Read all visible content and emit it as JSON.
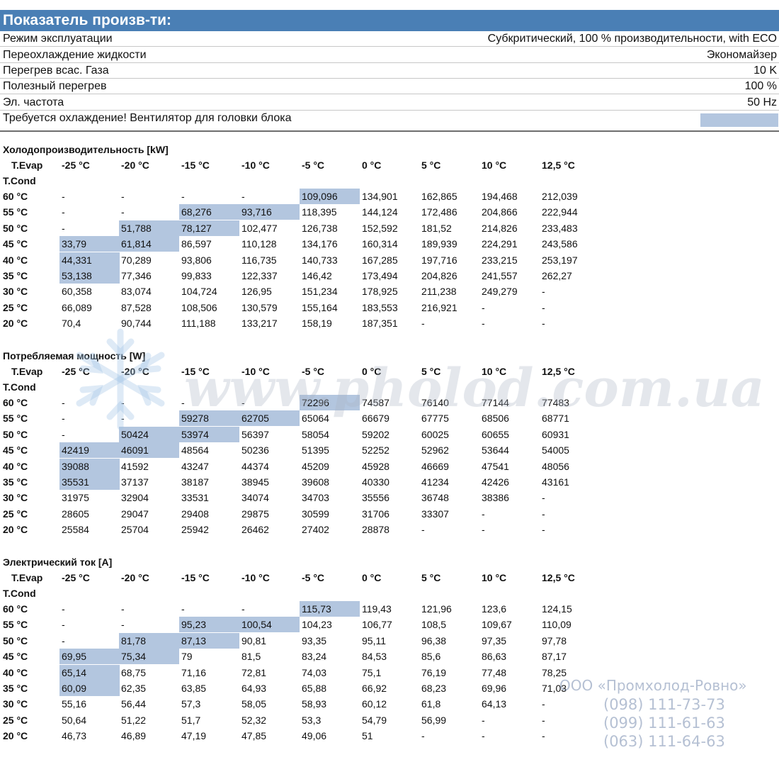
{
  "header": {
    "title": "Показатель произв-ти:"
  },
  "properties": [
    {
      "label": "Режим эксплуатации",
      "value": "Субкритический, 100 % производительности, with ECO"
    },
    {
      "label": "Переохлаждение жидкости",
      "value": "Экономайзер"
    },
    {
      "label": "Перегрев всас. Газа",
      "value": "10 K"
    },
    {
      "label": "Полезный перегрев",
      "value": "100 %"
    },
    {
      "label": "Эл. частота",
      "value": "50 Hz"
    },
    {
      "label": "Требуется охлаждение! Вентилятор для головки блока",
      "value": ""
    }
  ],
  "table_header": {
    "evap_label": "T.Evap",
    "cond_label": "T.Cond",
    "columns": [
      "-25 °C",
      "-20 °C",
      "-15 °C",
      "-10 °C",
      "-5 °C",
      "0 °C",
      "5 °C",
      "10 °C",
      "12,5 °C"
    ],
    "rows": [
      "60 °C",
      "55 °C",
      "50 °C",
      "45 °C",
      "40 °C",
      "35 °C",
      "30 °C",
      "25 °C",
      "20 °C"
    ]
  },
  "sections": [
    {
      "title": "Холодопроизводительность [kW]",
      "values": [
        [
          "-",
          "-",
          "-",
          "-",
          "109,096",
          "134,901",
          "162,865",
          "194,468",
          "212,039"
        ],
        [
          "-",
          "-",
          "68,276",
          "93,716",
          "118,395",
          "144,124",
          "172,486",
          "204,866",
          "222,944"
        ],
        [
          "-",
          "51,788",
          "78,127",
          "102,477",
          "126,738",
          "152,592",
          "181,52",
          "214,826",
          "233,483"
        ],
        [
          "33,79",
          "61,814",
          "86,597",
          "110,128",
          "134,176",
          "160,314",
          "189,939",
          "224,291",
          "243,586"
        ],
        [
          "44,331",
          "70,289",
          "93,806",
          "116,735",
          "140,733",
          "167,285",
          "197,716",
          "233,215",
          "253,197"
        ],
        [
          "53,138",
          "77,346",
          "99,833",
          "122,337",
          "146,42",
          "173,494",
          "204,826",
          "241,557",
          "262,27"
        ],
        [
          "60,358",
          "83,074",
          "104,724",
          "126,95",
          "151,234",
          "178,925",
          "211,238",
          "249,279",
          "-"
        ],
        [
          "66,089",
          "87,528",
          "108,506",
          "130,579",
          "155,164",
          "183,553",
          "216,921",
          "-",
          "-"
        ],
        [
          "70,4",
          "90,744",
          "111,188",
          "133,217",
          "158,19",
          "187,351",
          "-",
          "-",
          "-"
        ]
      ]
    },
    {
      "title": "Потребляемая мощность [W]",
      "values": [
        [
          "-",
          "-",
          "-",
          "-",
          "72296",
          "74587",
          "76140",
          "77144",
          "77483"
        ],
        [
          "-",
          "-",
          "59278",
          "62705",
          "65064",
          "66679",
          "67775",
          "68506",
          "68771"
        ],
        [
          "-",
          "50424",
          "53974",
          "56397",
          "58054",
          "59202",
          "60025",
          "60655",
          "60931"
        ],
        [
          "42419",
          "46091",
          "48564",
          "50236",
          "51395",
          "52252",
          "52962",
          "53644",
          "54005"
        ],
        [
          "39088",
          "41592",
          "43247",
          "44374",
          "45209",
          "45928",
          "46669",
          "47541",
          "48056"
        ],
        [
          "35531",
          "37137",
          "38187",
          "38945",
          "39608",
          "40330",
          "41234",
          "42426",
          "43161"
        ],
        [
          "31975",
          "32904",
          "33531",
          "34074",
          "34703",
          "35556",
          "36748",
          "38386",
          "-"
        ],
        [
          "28605",
          "29047",
          "29408",
          "29875",
          "30599",
          "31706",
          "33307",
          "-",
          "-"
        ],
        [
          "25584",
          "25704",
          "25942",
          "26462",
          "27402",
          "28878",
          "-",
          "-",
          "-"
        ]
      ]
    },
    {
      "title": "Электрический ток [A]",
      "values": [
        [
          "-",
          "-",
          "-",
          "-",
          "115,73",
          "119,43",
          "121,96",
          "123,6",
          "124,15"
        ],
        [
          "-",
          "-",
          "95,23",
          "100,54",
          "104,23",
          "106,77",
          "108,5",
          "109,67",
          "110,09"
        ],
        [
          "-",
          "81,78",
          "87,13",
          "90,81",
          "93,35",
          "95,11",
          "96,38",
          "97,35",
          "97,78"
        ],
        [
          "69,95",
          "75,34",
          "79",
          "81,5",
          "83,24",
          "84,53",
          "85,6",
          "86,63",
          "87,17"
        ],
        [
          "65,14",
          "68,75",
          "71,16",
          "72,81",
          "74,03",
          "75,1",
          "76,19",
          "77,48",
          "78,25"
        ],
        [
          "60,09",
          "62,35",
          "63,85",
          "64,93",
          "65,88",
          "66,92",
          "68,23",
          "69,96",
          "71,03"
        ],
        [
          "55,16",
          "56,44",
          "57,3",
          "58,05",
          "58,93",
          "60,12",
          "61,8",
          "64,13",
          "-"
        ],
        [
          "50,64",
          "51,22",
          "51,7",
          "52,32",
          "53,3",
          "54,79",
          "56,99",
          "-",
          "-"
        ],
        [
          "46,73",
          "46,89",
          "47,19",
          "47,85",
          "49,06",
          "51",
          "-",
          "-",
          "-"
        ]
      ]
    }
  ],
  "highlighted_cells": [
    [
      0,
      4
    ],
    [
      1,
      2
    ],
    [
      1,
      3
    ],
    [
      2,
      1
    ],
    [
      2,
      2
    ],
    [
      3,
      0
    ],
    [
      3,
      1
    ],
    [
      4,
      0
    ],
    [
      5,
      0
    ]
  ],
  "watermark": {
    "site": "www.pholod.com.ua",
    "company": "ООО «Промхолод-Ровно»",
    "phones": [
      "(098) 111-73-73",
      "(099) 111-61-63",
      "(063) 111-64-63"
    ]
  },
  "colors": {
    "header_bg": "#4a7fb5",
    "highlight": "#b3c6df",
    "watermark": "#aab4c3"
  }
}
